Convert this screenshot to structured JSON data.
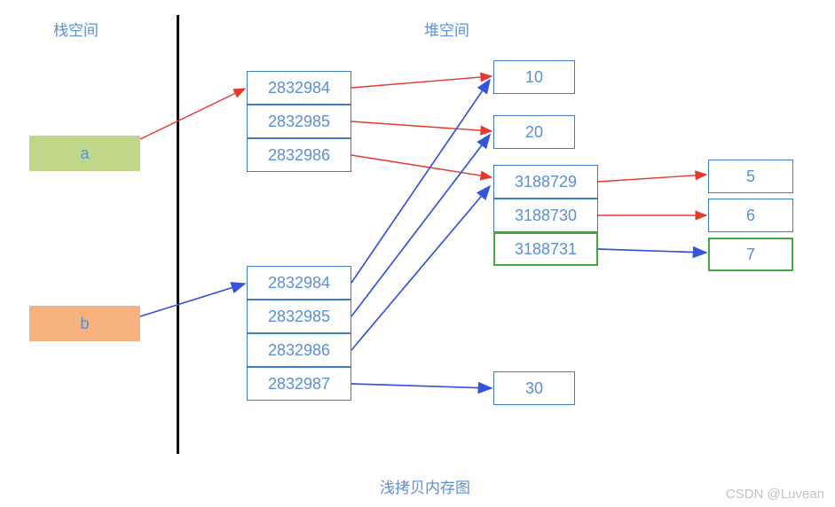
{
  "titles": {
    "stack": "栈空间",
    "heap": "堆空间",
    "caption": "浅拷贝内存图"
  },
  "vars": {
    "a": "a",
    "b": "b"
  },
  "listA": {
    "i0": "2832984",
    "i1": "2832985",
    "i2": "2832986"
  },
  "listB": {
    "i0": "2832984",
    "i1": "2832985",
    "i2": "2832986",
    "i3": "2832987"
  },
  "heap": {
    "v10": "10",
    "v20": "20",
    "v30": "30"
  },
  "sub": {
    "i0": "3188729",
    "i1": "3188730",
    "i2": "3188731"
  },
  "vals": {
    "v5": "5",
    "v6": "6",
    "v7": "7"
  },
  "watermark": "CSDN @Luvean"
}
